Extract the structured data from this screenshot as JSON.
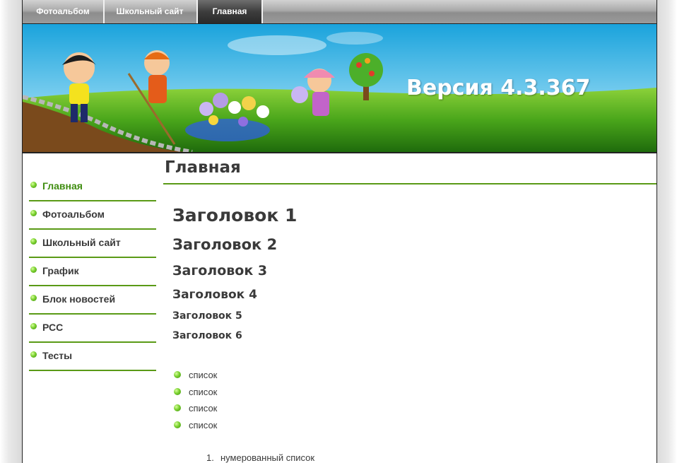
{
  "topnav": {
    "tabs": [
      {
        "label": "Фотоальбом",
        "active": false
      },
      {
        "label": "Школьный сайт",
        "active": false
      },
      {
        "label": "Главная",
        "active": true
      }
    ]
  },
  "banner": {
    "version_text": "Версия 4.3.367"
  },
  "sidebar": {
    "items": [
      {
        "label": "Главная",
        "active": true
      },
      {
        "label": "Фотоальбом",
        "active": false
      },
      {
        "label": "Школьный сайт",
        "active": false
      },
      {
        "label": "График",
        "active": false
      },
      {
        "label": "Блок новостей",
        "active": false
      },
      {
        "label": "РСС",
        "active": false
      },
      {
        "label": "Тесты",
        "active": false
      }
    ]
  },
  "content": {
    "title": "Главная",
    "headings": [
      "Заголовок 1",
      "Заголовок 2",
      "Заголовок 3",
      "Заголовок 4",
      "Заголовок 5",
      "Заголовок 6"
    ],
    "bullet_items": [
      "список",
      "список",
      "список",
      "список"
    ],
    "numbered_items": [
      {
        "number": "1.",
        "text": "нумерованный список"
      }
    ]
  },
  "colors": {
    "accent_green": "#5a9a16",
    "text_dark": "#3a3a3a",
    "active_tab": "#2a2a2a"
  }
}
